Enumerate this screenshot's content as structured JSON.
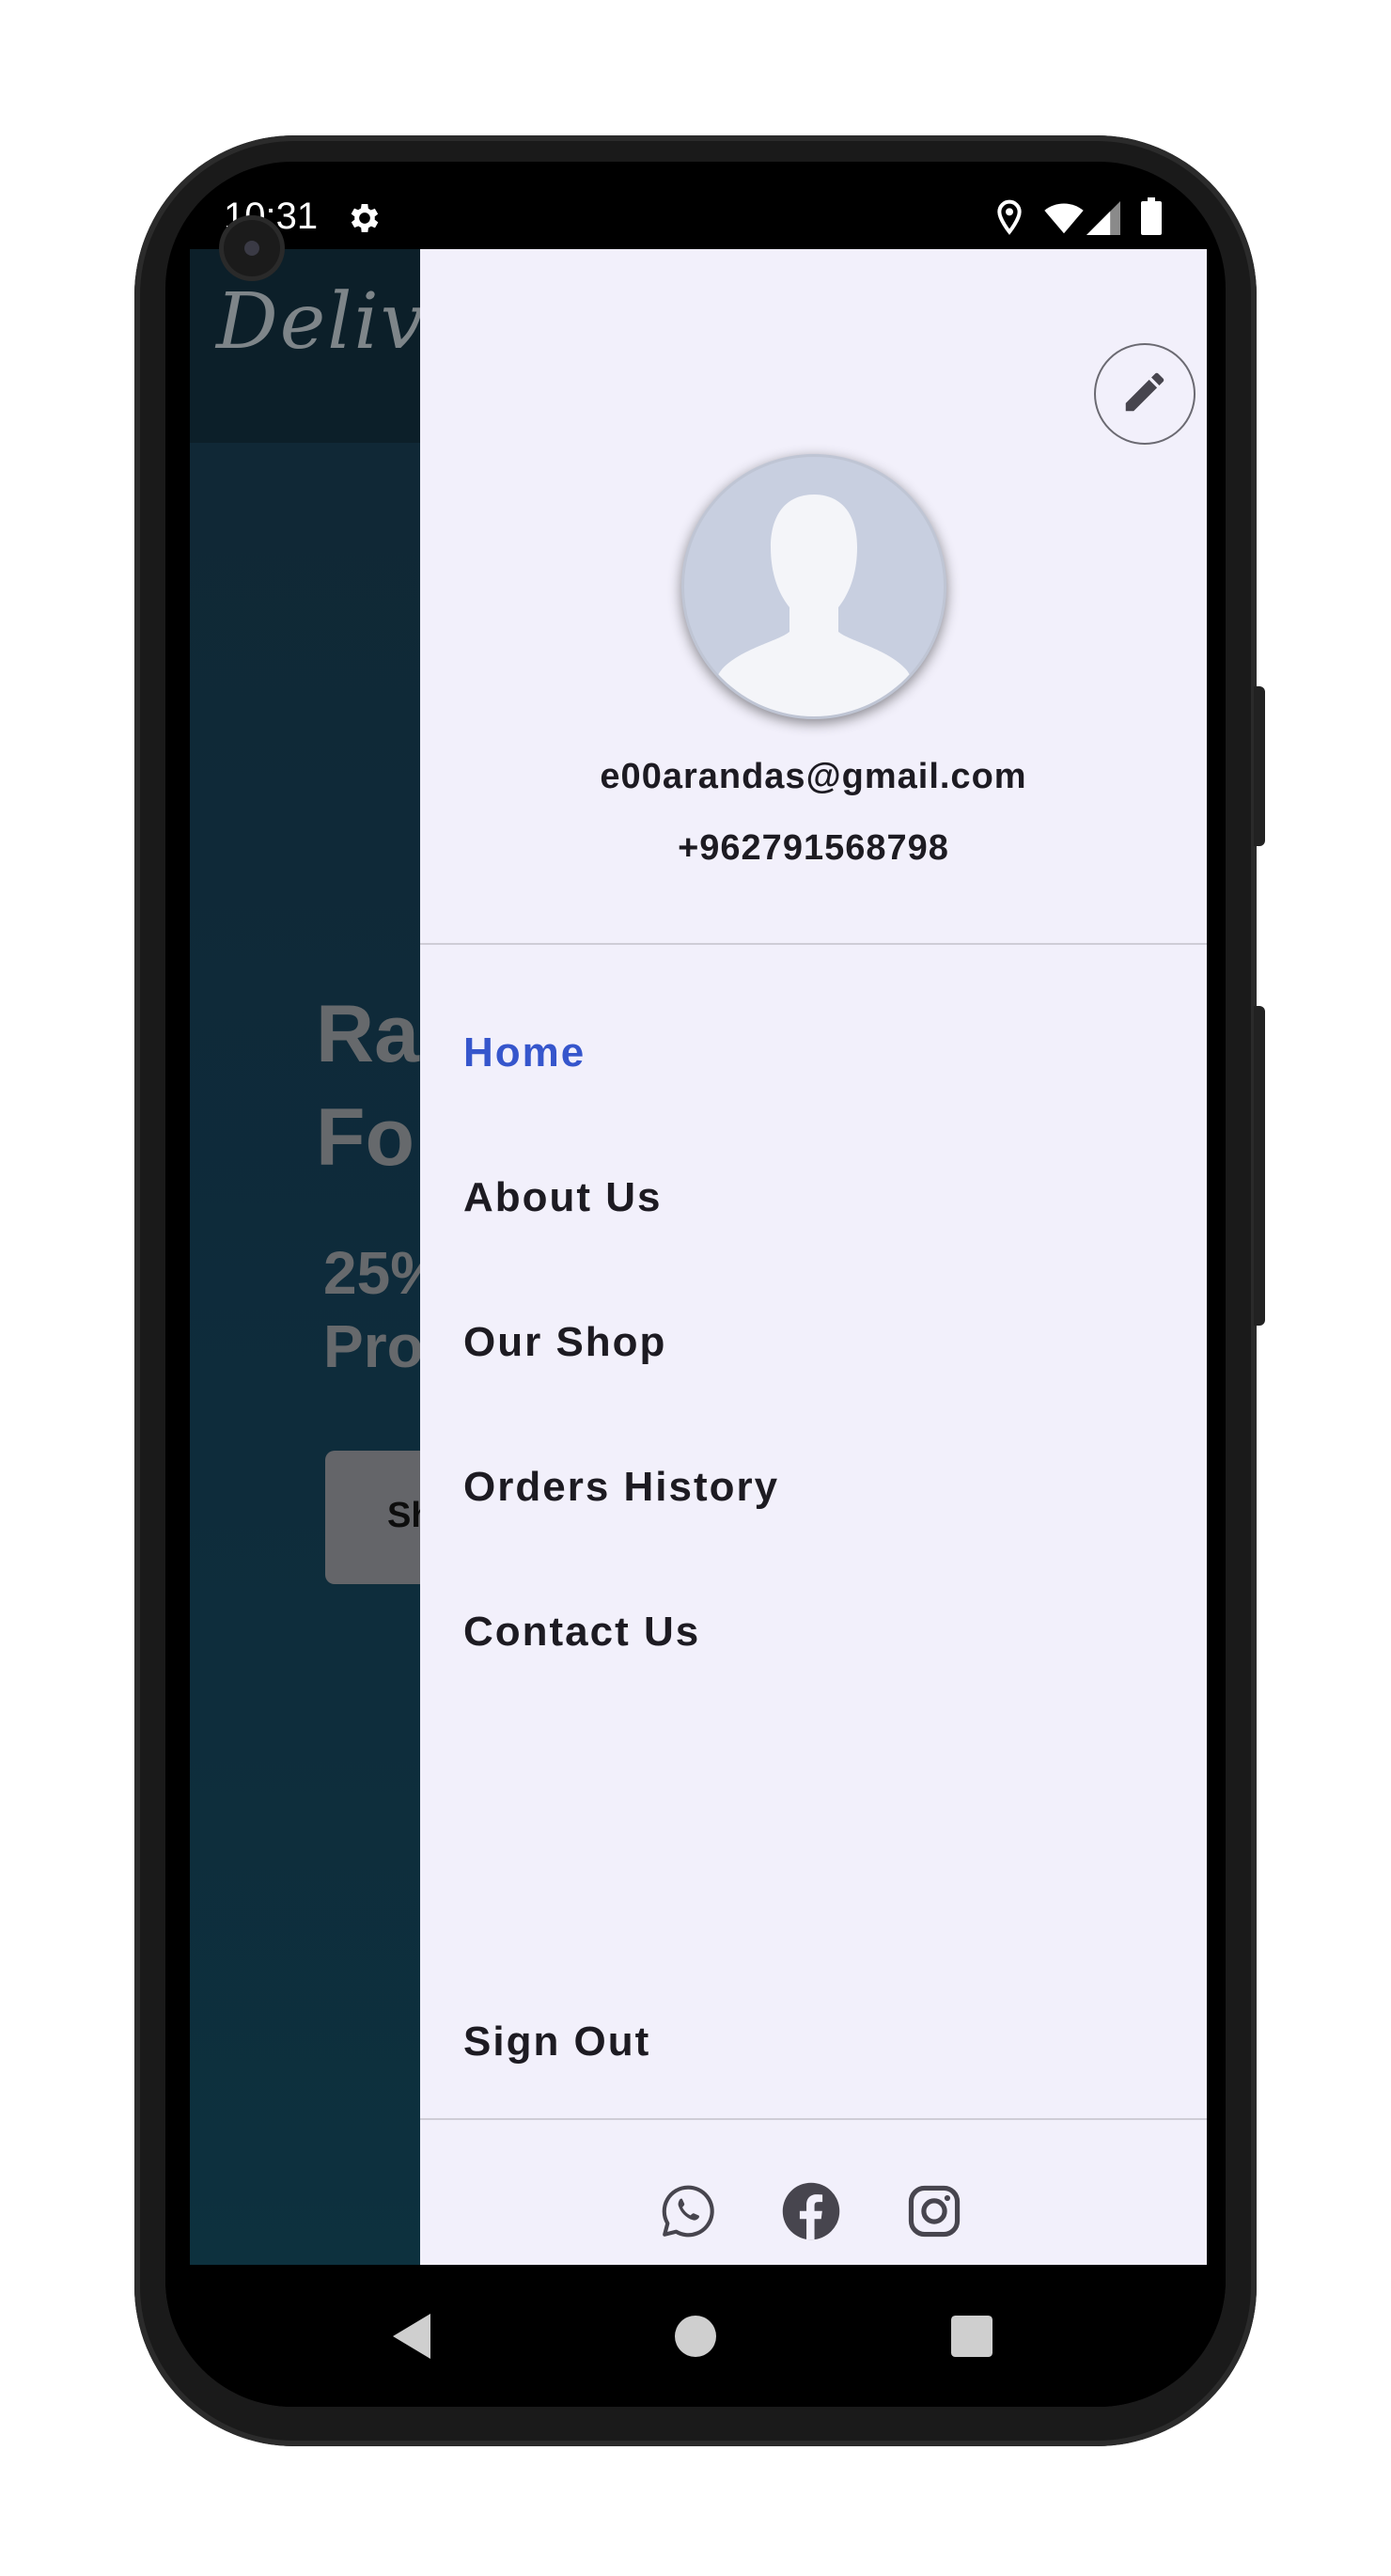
{
  "status_bar": {
    "time": "10:31",
    "left_icons": [
      "gear-icon"
    ],
    "right_icons": [
      "location-icon",
      "wifi-icon",
      "signal-icon",
      "battery-icon"
    ]
  },
  "background_app": {
    "logo_text": "Delive",
    "hero_title": "Ra\nFo",
    "hero_subtitle": "25%\nPro",
    "button_label": "Sh"
  },
  "drawer": {
    "edit_icon": "pencil-icon",
    "avatar_icon": "person-silhouette-icon",
    "email": "e00arandas@gmail.com",
    "phone": "+962791568798",
    "menu_items": [
      {
        "label": "Home",
        "active": true
      },
      {
        "label": "About Us",
        "active": false
      },
      {
        "label": "Our Shop",
        "active": false
      },
      {
        "label": "Orders History",
        "active": false
      },
      {
        "label": "Contact Us",
        "active": false
      }
    ],
    "sign_out_label": "Sign Out",
    "social_icons": [
      "whatsapp-icon",
      "facebook-icon",
      "instagram-icon"
    ]
  },
  "nav_bar": {
    "buttons": [
      "back-icon",
      "home-icon",
      "recents-icon"
    ]
  },
  "colors": {
    "drawer_background": "#f2f0fb",
    "active_menu": "#3656cc",
    "menu_text": "#1d1b22",
    "app_background": "#143041"
  }
}
